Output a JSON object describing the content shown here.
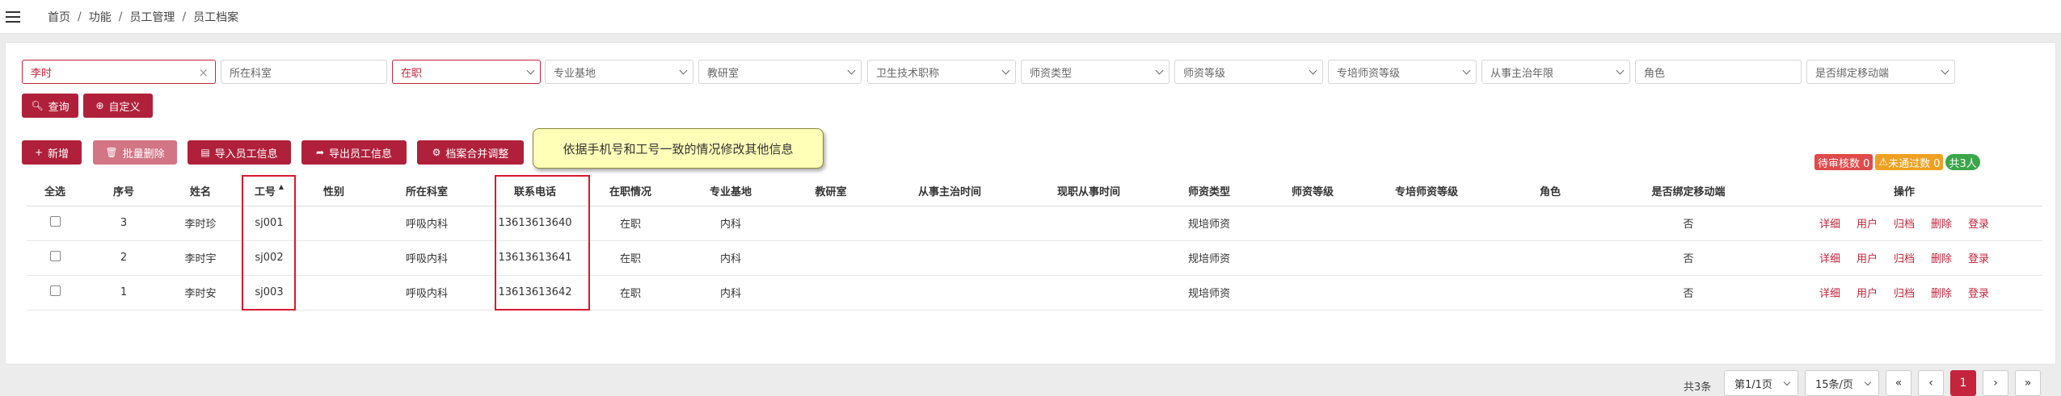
{
  "breadcrumb": [
    "首页",
    "功能",
    "员工管理",
    "员工档案"
  ],
  "filters": {
    "name": "李时",
    "dept_placeholder": "所在科室",
    "status": "在职",
    "base": "专业基地",
    "teaching": "教研室",
    "title": "卫生技术职称",
    "teacher_type": "师资类型",
    "teacher_level": "师资等级",
    "special_level": "专培师资等级",
    "years": "从事主治年限",
    "role_placeholder": "角色",
    "bind": "是否绑定移动端"
  },
  "buttons": {
    "query": "查询",
    "custom": "自定义",
    "add": "新增",
    "batch_delete": "批量删除",
    "import": "导入员工信息",
    "export": "导出员工信息",
    "merge": "档案合并调整"
  },
  "tooltip": "依据手机号和工号一致的情况修改其他信息",
  "badges": {
    "pending": "待审核数 0",
    "rejected": "未通过数 0",
    "total": "共3人"
  },
  "table": {
    "headers": [
      "全选",
      "序号",
      "姓名",
      "工号",
      "性别",
      "所在科室",
      "联系电话",
      "在职情况",
      "专业基地",
      "教研室",
      "从事主治时间",
      "现职从事时间",
      "师资类型",
      "师资等级",
      "专培师资等级",
      "角色",
      "是否绑定移动端",
      "操作"
    ],
    "rows": [
      {
        "no": "3",
        "name": "李时珍",
        "id": "sj001",
        "gender": "",
        "dept": "呼吸内科",
        "phone": "13613613640",
        "status": "在职",
        "base": "内科",
        "teaching": "",
        "attend": "",
        "current": "",
        "type": "规培师资",
        "level": "",
        "special": "",
        "role": "",
        "bind": "否"
      },
      {
        "no": "2",
        "name": "李时宇",
        "id": "sj002",
        "gender": "",
        "dept": "呼吸内科",
        "phone": "13613613641",
        "status": "在职",
        "base": "内科",
        "teaching": "",
        "attend": "",
        "current": "",
        "type": "规培师资",
        "level": "",
        "special": "",
        "role": "",
        "bind": "否"
      },
      {
        "no": "1",
        "name": "李时安",
        "id": "sj003",
        "gender": "",
        "dept": "呼吸内科",
        "phone": "13613613642",
        "status": "在职",
        "base": "内科",
        "teaching": "",
        "attend": "",
        "current": "",
        "type": "规培师资",
        "level": "",
        "special": "",
        "role": "",
        "bind": "否"
      }
    ],
    "ops": [
      "详细",
      "用户",
      "归档",
      "删除",
      "登录"
    ]
  },
  "pager": {
    "total": "共3条",
    "page": "第1/1页",
    "size": "15条/页",
    "first": "«",
    "prev": "‹",
    "current": "1",
    "next": "›",
    "last": "»"
  }
}
